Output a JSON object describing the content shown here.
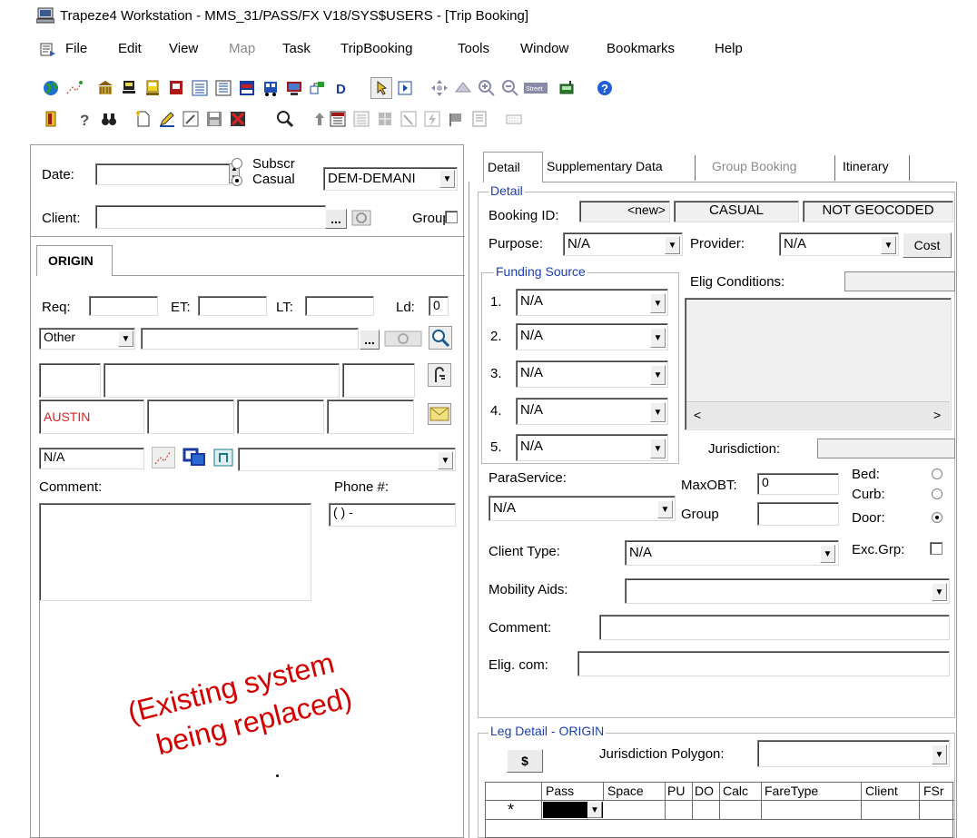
{
  "window": {
    "title": "Trapeze4 Workstation - MMS_31/PASS/FX V18/SYS$USERS - [Trip Booking]"
  },
  "menu": [
    "File",
    "Edit",
    "View",
    "Map",
    "Task",
    "TripBooking",
    "Tools",
    "Window",
    "Bookmarks",
    "Help"
  ],
  "left": {
    "date_label": "Date:",
    "subscr_label": "Subscr",
    "casual_label": "Casual",
    "booking_type": "DEM-DEMANI",
    "client_label": "Client:",
    "group_label": "Group",
    "origin_tab": "ORIGIN",
    "req_label": "Req:",
    "et_label": "ET:",
    "lt_label": "LT:",
    "ld_label": "Ld:",
    "ld_value": "0",
    "address_type": "Other",
    "city": "AUSTIN",
    "na_value": "N/A",
    "comment_label": "Comment:",
    "phone_label": "Phone #:",
    "phone_value": "(   )   -"
  },
  "right": {
    "tabs": [
      "Detail",
      "Supplementary Data",
      "Group Booking",
      "Itinerary"
    ],
    "detail_group": "Detail",
    "booking_id_label": "Booking ID:",
    "booking_id": "<new>",
    "casual_status": "CASUAL",
    "geocode_status": "NOT GEOCODED",
    "purpose_label": "Purpose:",
    "purpose": "N/A",
    "provider_label": "Provider:",
    "provider": "N/A",
    "cost_button": "Cost",
    "funding_group": "Funding Source",
    "funding": [
      {
        "num": "1.",
        "value": "N/A"
      },
      {
        "num": "2.",
        "value": "N/A"
      },
      {
        "num": "3.",
        "value": "N/A"
      },
      {
        "num": "4.",
        "value": "N/A"
      },
      {
        "num": "5.",
        "value": "N/A"
      }
    ],
    "elig_conditions_label": "Elig Conditions:",
    "jurisdiction_label": "Jurisdiction:",
    "paraservice_label": "ParaService:",
    "paraservice": "N/A",
    "maxobt_label": "MaxOBT:",
    "maxobt": "0",
    "group_label": "Group",
    "bed_label": "Bed:",
    "curb_label": "Curb:",
    "door_label": "Door:",
    "client_type_label": "Client Type:",
    "client_type": "N/A",
    "excgrp_label": "Exc.Grp:",
    "mobility_label": "Mobility Aids:",
    "comment_label": "Comment:",
    "elig_com_label": "Elig. com:",
    "leg_group": "Leg Detail - ORIGIN",
    "dollar_button": "$",
    "jur_polygon_label": "Jurisdiction Polygon:",
    "grid_headers": [
      "Pass",
      "Space",
      "PU",
      "DO",
      "Calc",
      "FareType",
      "Client",
      "FSr"
    ],
    "new_row_marker": "*"
  },
  "overlay": {
    "line1": "(Existing system",
    "line2": "being replaced)",
    "color": "#d40000"
  }
}
